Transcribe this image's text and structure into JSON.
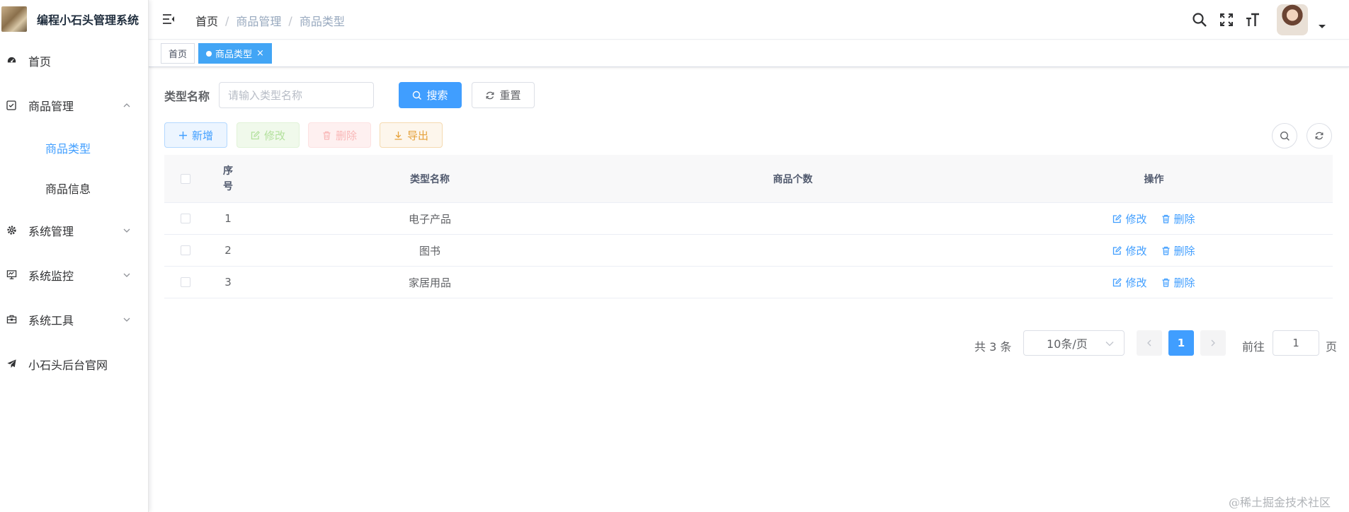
{
  "app": {
    "title": "编程小石头管理系统"
  },
  "sidebar": {
    "items": [
      {
        "label": "首页"
      },
      {
        "label": "商品管理",
        "children": [
          {
            "label": "商品类型"
          },
          {
            "label": "商品信息"
          }
        ]
      },
      {
        "label": "系统管理"
      },
      {
        "label": "系统监控"
      },
      {
        "label": "系统工具"
      },
      {
        "label": "小石头后台官网"
      }
    ]
  },
  "header": {
    "breadcrumb": [
      "首页",
      "商品管理",
      "商品类型"
    ],
    "separator": "/"
  },
  "tags": [
    {
      "label": "首页"
    },
    {
      "label": "商品类型",
      "close": "×"
    }
  ],
  "search": {
    "label": "类型名称",
    "placeholder": "请输入类型名称",
    "search_button": "搜索",
    "reset_button": "重置"
  },
  "toolbar": {
    "add": "新增",
    "edit": "修改",
    "delete": "删除",
    "export": "导出"
  },
  "table": {
    "columns": [
      "序号",
      "类型名称",
      "商品个数",
      "操作"
    ],
    "rows": [
      {
        "index": "1",
        "name": "电子产品",
        "count": ""
      },
      {
        "index": "2",
        "name": "图书",
        "count": ""
      },
      {
        "index": "3",
        "name": "家居用品",
        "count": ""
      }
    ],
    "actions": {
      "edit": "修改",
      "delete": "删除"
    }
  },
  "pagination": {
    "total": "共 3 条",
    "page_size": "10条/页",
    "current_page": "1",
    "goto_prefix": "前往",
    "goto_value": "1",
    "goto_suffix": "页"
  },
  "watermark": "@稀土掘金技术社区",
  "colors": {
    "primary": "#409eff",
    "tag_active": "#42a5f5"
  }
}
